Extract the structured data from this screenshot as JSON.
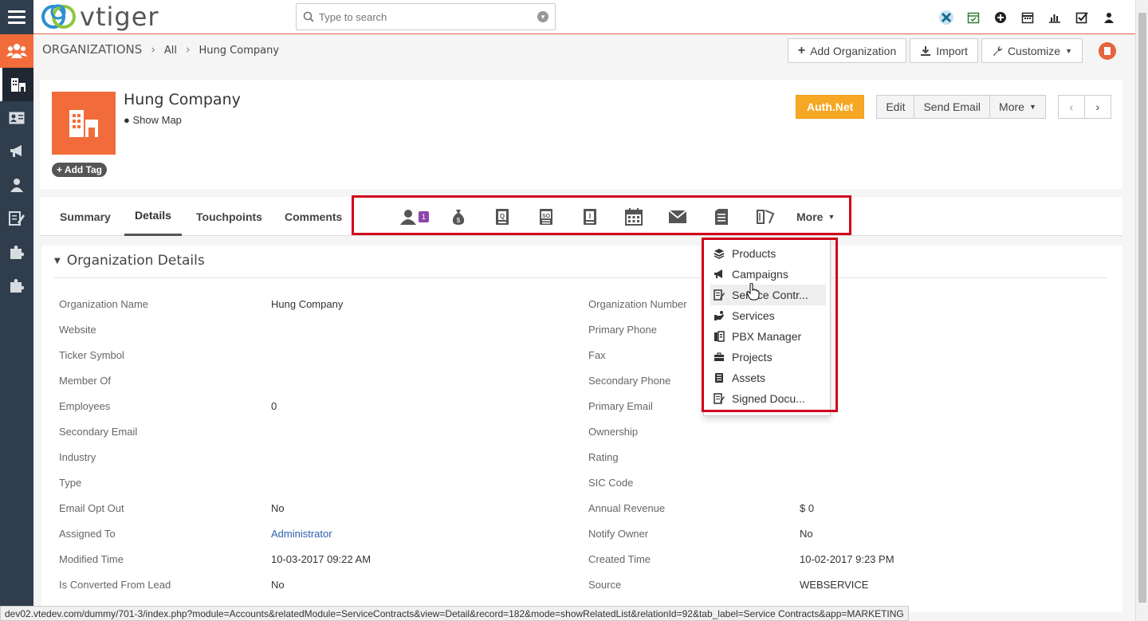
{
  "brand": {
    "name": "vtiger"
  },
  "search": {
    "placeholder": "Type to search"
  },
  "breadcrumb": {
    "module": "ORGANIZATIONS",
    "filter": "All",
    "record": "Hung Company"
  },
  "header_buttons": {
    "add": "Add Organization",
    "import": "Import",
    "customize": "Customize"
  },
  "record": {
    "name": "Hung Company",
    "show_map": "Show Map",
    "add_tag": "Add Tag"
  },
  "record_buttons": {
    "auth": "Auth.Net",
    "edit": "Edit",
    "send_email": "Send Email",
    "more": "More"
  },
  "tabs": {
    "summary": "Summary",
    "details": "Details",
    "touchpoints": "Touchpoints",
    "comments": "Comments",
    "more": "More",
    "contacts_badge": "1"
  },
  "section_title": "Organization Details",
  "fields_left": [
    {
      "label": "Organization Name",
      "value": "Hung Company"
    },
    {
      "label": "Website",
      "value": ""
    },
    {
      "label": "Ticker Symbol",
      "value": ""
    },
    {
      "label": "Member Of",
      "value": ""
    },
    {
      "label": "Employees",
      "value": "0"
    },
    {
      "label": "Secondary Email",
      "value": ""
    },
    {
      "label": "Industry",
      "value": ""
    },
    {
      "label": "Type",
      "value": ""
    },
    {
      "label": "Email Opt Out",
      "value": "No"
    },
    {
      "label": "Assigned To",
      "value": "Administrator"
    },
    {
      "label": "Modified Time",
      "value": "10-03-2017 09:22 AM"
    },
    {
      "label": "Is Converted From Lead",
      "value": "No"
    }
  ],
  "fields_right": [
    {
      "label": "Organization Number",
      "value": ""
    },
    {
      "label": "Primary Phone",
      "value": ""
    },
    {
      "label": "Fax",
      "value": ""
    },
    {
      "label": "Secondary Phone",
      "value": ""
    },
    {
      "label": "Primary Email",
      "value": ""
    },
    {
      "label": "Ownership",
      "value": ""
    },
    {
      "label": "Rating",
      "value": ""
    },
    {
      "label": "SIC Code",
      "value": ""
    },
    {
      "label": "Annual Revenue",
      "value": "$ 0"
    },
    {
      "label": "Notify Owner",
      "value": "No"
    },
    {
      "label": "Created Time",
      "value": "10-02-2017 9:23 PM"
    },
    {
      "label": "Source",
      "value": "WEBSERVICE"
    }
  ],
  "more_menu": [
    {
      "label": "Products",
      "icon": "products-icon"
    },
    {
      "label": "Campaigns",
      "icon": "campaigns-icon"
    },
    {
      "label": "Service Contr...",
      "icon": "service-contracts-icon"
    },
    {
      "label": "Services",
      "icon": "services-icon"
    },
    {
      "label": "PBX Manager",
      "icon": "pbx-manager-icon"
    },
    {
      "label": "Projects",
      "icon": "projects-icon"
    },
    {
      "label": "Assets",
      "icon": "assets-icon"
    },
    {
      "label": "Signed Docu...",
      "icon": "signed-documents-icon"
    }
  ],
  "status_url": "dev02.vtedev.com/dummy/701-3/index.php?module=Accounts&relatedModule=ServiceContracts&view=Detail&record=182&mode=showRelatedList&relationId=92&tab_label=Service Contracts&app=MARKETING",
  "colors": {
    "accent": "#f26c3b",
    "sidebar": "#2f3d4d",
    "auth_button": "#f6a723",
    "highlight": "#d0021b"
  }
}
